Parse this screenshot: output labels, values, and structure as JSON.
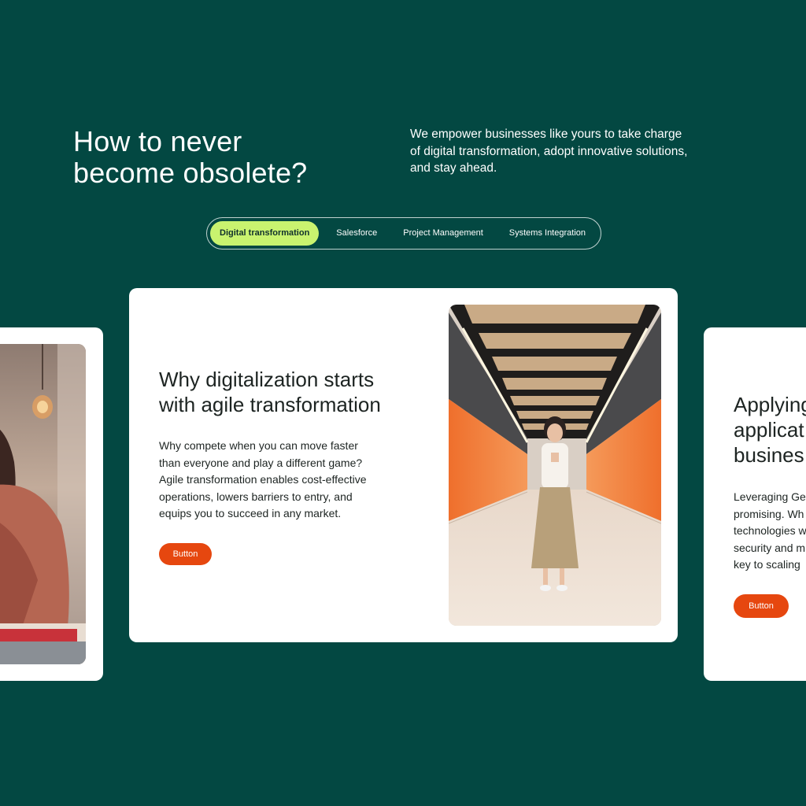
{
  "hero": {
    "title_lines": [
      "How to never",
      "become obsolete?"
    ],
    "intro_lines": [
      "We empower businesses like yours to take charge",
      "of digital transformation, adopt innovative solutions,",
      "and stay ahead."
    ]
  },
  "tabs": [
    {
      "label": "Digital transformation",
      "active": true
    },
    {
      "label": "Salesforce",
      "active": false
    },
    {
      "label": "Project Management",
      "active": false
    },
    {
      "label": "Systems Integration",
      "active": false
    }
  ],
  "cards": {
    "main": {
      "title_lines": [
        "Why digitalization starts",
        "with agile transformation"
      ],
      "body_lines": [
        "Why compete when you can move faster",
        "than everyone and play a different game?",
        "Agile transformation enables cost-effective",
        "operations, lowers barriers to entry, and",
        "equips you to succeed in any market."
      ],
      "button_label": "Button"
    },
    "right": {
      "title_lines": [
        "Applying",
        "applicat",
        "busines"
      ],
      "body_lines": [
        "Leveraging Ge",
        "promising. Wh",
        "technologies w",
        "security and m",
        "key to scaling"
      ],
      "button_label": "Button"
    }
  },
  "colors": {
    "background": "#034842",
    "tab_active": "#c9f36f",
    "button": "#e6470f",
    "tunnel_orange": "#f07a3c"
  }
}
